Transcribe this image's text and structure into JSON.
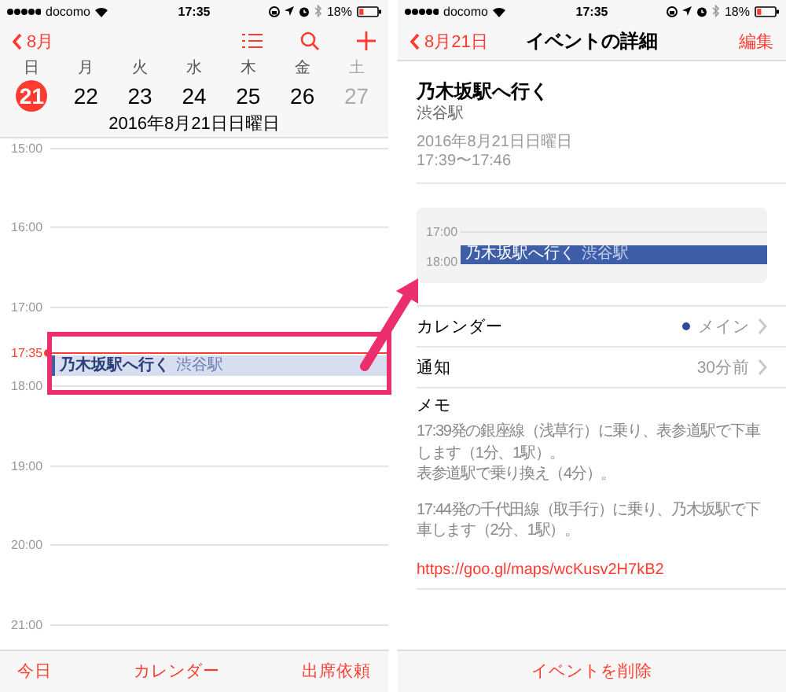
{
  "day_view": {
    "status_bar": {
      "carrier": "docomo",
      "time": "17:35",
      "battery": "18%"
    },
    "nav": {
      "back": "8月"
    },
    "weekdays": [
      "日",
      "月",
      "火",
      "水",
      "木",
      "金",
      "土"
    ],
    "days": [
      {
        "label": "21",
        "selected": true,
        "dimmed": false
      },
      {
        "label": "22",
        "selected": false,
        "dimmed": false
      },
      {
        "label": "23",
        "selected": false,
        "dimmed": false
      },
      {
        "label": "24",
        "selected": false,
        "dimmed": false
      },
      {
        "label": "25",
        "selected": false,
        "dimmed": false
      },
      {
        "label": "26",
        "selected": false,
        "dimmed": false
      },
      {
        "label": "27",
        "selected": false,
        "dimmed": true
      }
    ],
    "date_heading": "2016年8月21日日曜日",
    "hours": [
      "15:00",
      "16:00",
      "17:00",
      "18:00",
      "19:00",
      "20:00",
      "21:00"
    ],
    "now": {
      "label": "17:35"
    },
    "event": {
      "title": "乃木坂駅へ行く",
      "location": "渋谷駅"
    },
    "tab_bar": [
      "今日",
      "カレンダー",
      "出席依頼"
    ]
  },
  "event_detail": {
    "status_bar": {
      "carrier": "docomo",
      "time": "17:35",
      "battery": "18%"
    },
    "nav": {
      "back": "8月21日",
      "title": "イベントの詳細",
      "edit": "編集"
    },
    "title": "乃木坂駅へ行く",
    "location": "渋谷駅",
    "date": "2016年8月21日日曜日",
    "time": "17:39〜17:46",
    "mini_calendar": {
      "hours": [
        "17:00",
        "18:00"
      ],
      "event": {
        "title": "乃木坂駅へ行く",
        "location": "渋谷駅"
      }
    },
    "rows": [
      {
        "label": "カレンダー",
        "value": "メイン",
        "color": "#2b4a9b"
      },
      {
        "label": "通知",
        "value": "30分前"
      }
    ],
    "memo": {
      "label": "メモ",
      "paragraphs": [
        [
          "17:39発の銀座線（浅草行）に乗り、表参道駅で下車します（1分、1駅）。",
          "表参道駅で乗り換え（4分）。"
        ],
        [
          "17:44発の千代田線（取手行）に乗り、乃木坂駅で下車します（2分、1駅）。"
        ]
      ],
      "link": "https://goo.gl/maps/wcKusv2H7kB2"
    },
    "bottom_bar": {
      "delete": "イベントを削除"
    }
  },
  "annotation": {
    "highlight_frame": true,
    "arrow": true
  }
}
